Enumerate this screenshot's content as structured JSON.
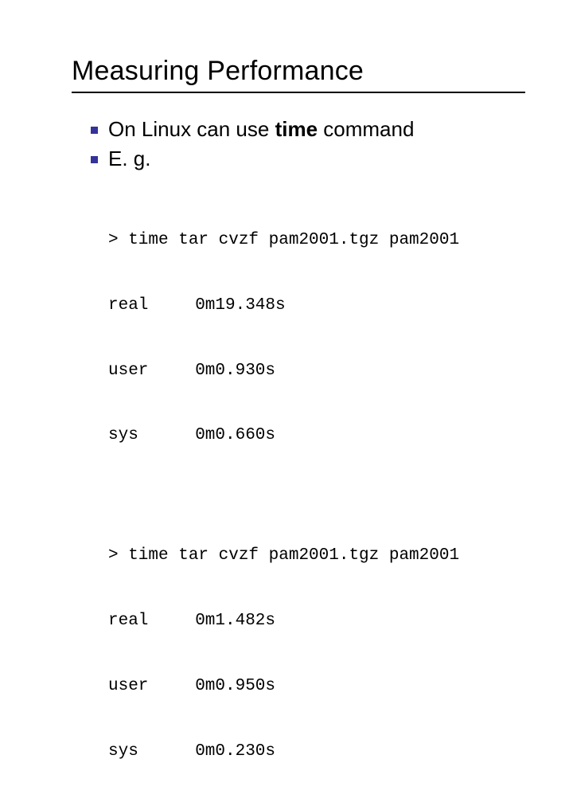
{
  "title": "Measuring Performance",
  "bullets": {
    "b1_pre": "On Linux can use ",
    "b1_bold": "time",
    "b1_post": " command",
    "b2": "E. g."
  },
  "run1": {
    "cmd": "> time tar cvzf pam2001.tgz pam2001",
    "real_lbl": "real",
    "real_val": "0m19.348s",
    "user_lbl": "user",
    "user_val": "0m0.930s",
    "sys_lbl": "sys",
    "sys_val": "0m0.660s"
  },
  "run2": {
    "cmd": "> time tar cvzf pam2001.tgz pam2001",
    "real_lbl": "real",
    "real_val": "0m1.482s",
    "user_lbl": "user",
    "user_val": "0m0.950s",
    "sys_lbl": "sys",
    "sys_val": "0m0.230s"
  }
}
